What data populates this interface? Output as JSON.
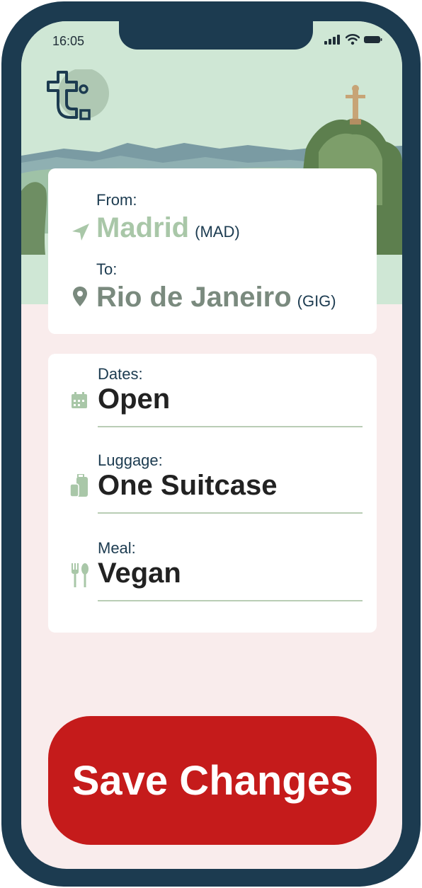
{
  "status_bar": {
    "time": "16:05"
  },
  "route": {
    "from_label": "From:",
    "from_city": "Madrid",
    "from_code": "(MAD)",
    "to_label": "To:",
    "to_city": "Rio de Janeiro",
    "to_code": "(GIG)"
  },
  "options": [
    {
      "label": "Dates:",
      "value": "Open",
      "icon": "calendar-icon"
    },
    {
      "label": "Luggage:",
      "value": "One Suitcase",
      "icon": "luggage-icon"
    },
    {
      "label": "Meal:",
      "value": "Vegan",
      "icon": "fork-knife-icon"
    }
  ],
  "actions": {
    "save_label": "Save Changes"
  },
  "colors": {
    "frame": "#1c3b50",
    "accent_green": "#a9c7a8",
    "city_gray": "#7a8a7e",
    "save_red": "#c51b1b",
    "background_pink": "#f9ecec"
  }
}
